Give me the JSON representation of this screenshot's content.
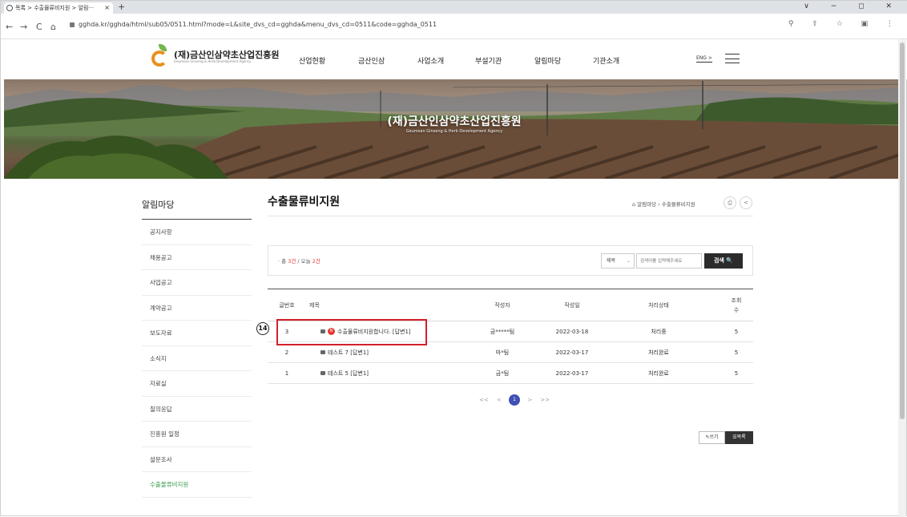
{
  "browser": {
    "tab_title": "목록 > 수출물류비지원 > 알림···",
    "tab_close": "×",
    "new_tab": "+",
    "window_controls": "∨ − ◻ ✕",
    "back": "←",
    "forward": "→",
    "reload": "C",
    "home": "⌂",
    "url": "gghda.kr/gghda/html/sub05/0511.html?mode=L&site_dvs_cd=gghda&menu_dvs_cd=0511&code=gghda_0511",
    "toolbar_icons": "⚲ ⇪ ☆ ▣ ⋮"
  },
  "header": {
    "logo_name": "(재)금산인삼약초산업진흥원",
    "logo_english": "Geumsan Ginseng & Herb Development Agency",
    "nav": [
      "산업현황",
      "금산인삼",
      "사업소개",
      "부설기관",
      "알림마당",
      "기관소개"
    ],
    "lang": "ENG >"
  },
  "banner": {
    "title": "(재)금산인삼약초산업진흥원",
    "subtitle": "Geumsan Ginseng & Herb Development Agency"
  },
  "sidebar": {
    "title": "알림마당",
    "items": [
      "공지사항",
      "채용공고",
      "사업공고",
      "계약공고",
      "보도자료",
      "소식지",
      "자료실",
      "질의응답",
      "진흥원 일정",
      "설문조사",
      "수출물류비지원"
    ]
  },
  "content": {
    "page_title": "수출물류비지원",
    "breadcrumb": "⌂  알림마당  ›  수출물류비지원",
    "print_icon": "⎙",
    "share_icon": "<",
    "count_prefix": "· 총 ",
    "count_total": "3건",
    "count_mid": " / 오늘 ",
    "count_today": "2건",
    "search_field": "제목",
    "search_caret": "⌄",
    "search_placeholder": "검색어를 입력해주세요",
    "search_button": "검색 🔍",
    "columns": [
      "글번호",
      "제목",
      "작성자",
      "작성일",
      "처리상태",
      "조회수"
    ],
    "rows": [
      {
        "no": "3",
        "title": "수출물류비지원합니다. [답변1]",
        "author": "금*****팀",
        "date": "2022-03-18",
        "status": "처리중",
        "views": "5",
        "is_new": true,
        "new_label": "N"
      },
      {
        "no": "2",
        "title": "테스트 7 [답변1]",
        "author": "마*팀",
        "date": "2022-03-17",
        "status": "처리완료",
        "views": "5",
        "is_new": false
      },
      {
        "no": "1",
        "title": "테스트 5 [답변1]",
        "author": "금*팀",
        "date": "2022-03-17",
        "status": "처리완료",
        "views": "5",
        "is_new": false
      }
    ],
    "annotation_marker": "14",
    "paging": {
      "first": "<<",
      "prev": "<",
      "current": "1",
      "next": ">",
      "last": ">>"
    },
    "write_button": "✎쓰기",
    "list_button": "☰목록"
  },
  "colors": {
    "accent_green": "#3a9d4f",
    "highlight_red": "#d3202b",
    "count_red": "#e6372f",
    "page_blue": "#3f51b5"
  }
}
